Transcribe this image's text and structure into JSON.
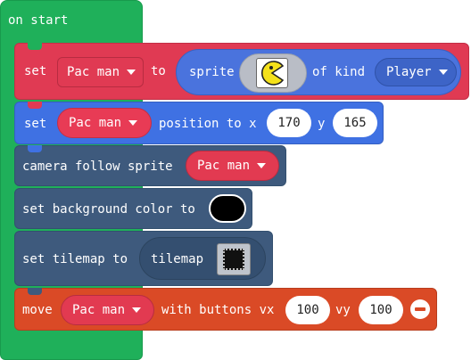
{
  "on_start": {
    "label": "on start"
  },
  "block_set_sprite": {
    "set_label": "set",
    "variable": "Pac man",
    "to_label": "to",
    "sprite_label": "sprite",
    "sprite_image_icon": "pacman-icon",
    "of_kind_label": "of kind",
    "kind_value": "Player"
  },
  "block_position": {
    "set_label": "set",
    "variable": "Pac man",
    "position_label": "position to x",
    "x_value": "170",
    "y_label": "y",
    "y_value": "165"
  },
  "block_camera": {
    "label": "camera follow sprite",
    "variable": "Pac man"
  },
  "block_background": {
    "label": "set background color to",
    "color": "#000000"
  },
  "block_tilemap": {
    "label": "set tilemap to",
    "tilemap_label": "tilemap",
    "tilemap_icon": "tilemap-icon"
  },
  "block_move": {
    "move_label": "move",
    "variable": "Pac man",
    "with_buttons_label": "with buttons vx",
    "vx_value": "100",
    "vy_label": "vy",
    "vy_value": "100",
    "remove_icon": "minus-circle-icon"
  },
  "colors": {
    "hat_green": "#1fb05a",
    "sprite_red": "#e03a53",
    "position_blue": "#3f71e3",
    "scene_slate": "#3e5a7d",
    "controller_orange": "#da4a26"
  }
}
